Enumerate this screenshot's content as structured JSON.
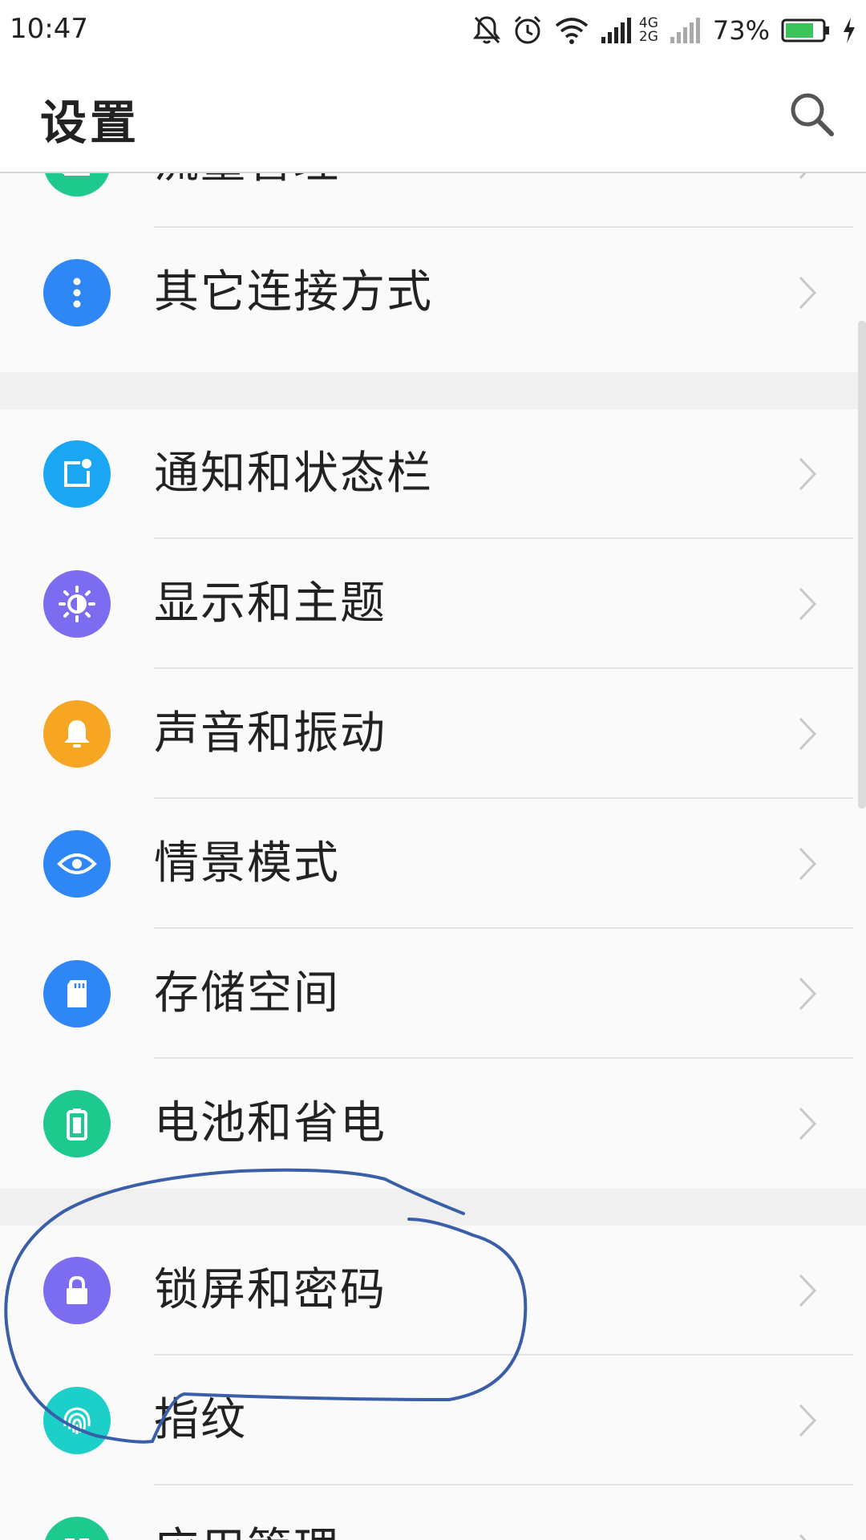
{
  "status_bar": {
    "time": "10:47",
    "net_top": "4G",
    "net_bottom": "2G",
    "battery": "73%",
    "icons": [
      "bell-off-icon",
      "alarm-icon",
      "wifi-icon",
      "signal-icon",
      "signal-weak-icon",
      "battery-icon",
      "charging-icon"
    ]
  },
  "header": {
    "title": "设置",
    "search_icon": "search-icon"
  },
  "colors": {
    "green": "#1ec98e",
    "blue": "#2f86f5",
    "cyan": "#1aa6f2",
    "purple": "#7b6cf0",
    "orange": "#f6a623",
    "teal": "#1ccfc8",
    "annotation": "#3a5ea8"
  },
  "items": [
    {
      "label": "流量管理",
      "icon": "chart-icon"
    },
    {
      "label": "其它连接方式",
      "icon": "more-dots-icon"
    },
    {
      "label": "通知和状态栏",
      "icon": "notification-icon"
    },
    {
      "label": "显示和主题",
      "icon": "brightness-icon"
    },
    {
      "label": "声音和振动",
      "icon": "bell-icon"
    },
    {
      "label": "情景模式",
      "icon": "eye-icon"
    },
    {
      "label": "存储空间",
      "icon": "sd-card-icon"
    },
    {
      "label": "电池和省电",
      "icon": "battery-icon"
    },
    {
      "label": "锁屏和密码",
      "icon": "lock-icon"
    },
    {
      "label": "指纹",
      "icon": "fingerprint-icon"
    },
    {
      "label": "应用管理",
      "icon": "apps-icon"
    }
  ]
}
